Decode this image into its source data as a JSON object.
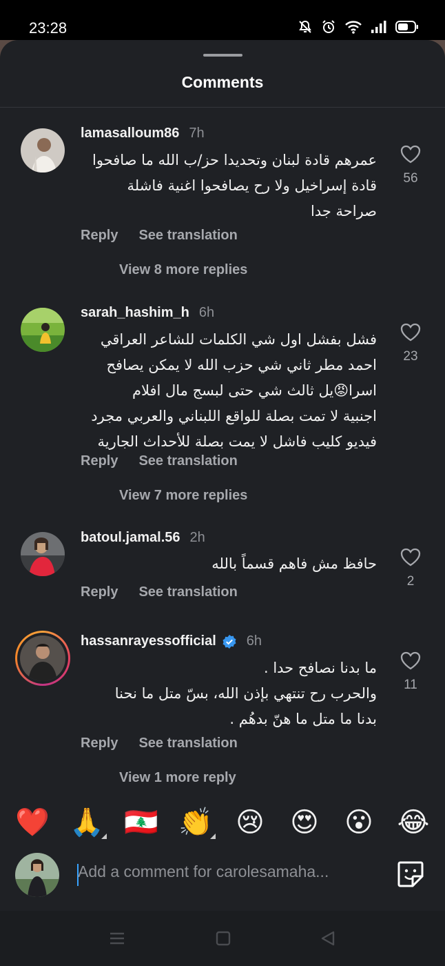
{
  "status_bar": {
    "time": "23:28",
    "icons": [
      "mute-icon",
      "alarm-icon",
      "wifi-icon",
      "signal-icon",
      "battery-icon"
    ]
  },
  "sheet": {
    "title": "Comments"
  },
  "actions": {
    "reply": "Reply",
    "see_translation": "See translation"
  },
  "comments": [
    {
      "username": "lamasalloum86",
      "time": "7h",
      "lines": [
        "عمرهم قادة لبنان وتحديدا حز/ب الله ما صافحوا",
        "قادة إسراخيل ولا رح يصافحوا اغنية فاشلة",
        "صراحة جدا"
      ],
      "likes": "56",
      "view_more": "View 8 more replies"
    },
    {
      "username": "sarah_hashim_h",
      "time": "6h",
      "lines": [
        "فشل بفشل اول شي الكلمات للشاعر العراقي",
        "احمد مطر ثاني شي حزب الله لا يمكن يصافح",
        "اسرا😡يل ثالث شي حتى لبسج مال افلام",
        "اجنبية لا تمت بصلة للواقع اللبناني والعربي مجرد",
        "فيديو كليب فاشل لا يمت بصلة للأحداث الجارية"
      ],
      "likes": "23",
      "view_more": "View 7 more replies"
    },
    {
      "username": "batoul.jamal.56",
      "time": "2h",
      "lines": [
        "حافظ مش فاهم قسماً بالله"
      ],
      "likes": "2"
    },
    {
      "username": "hassanrayessofficial",
      "time": "6h",
      "verified": true,
      "lines": [
        "ما بدنا نصافح حدا .",
        "والحرب رح تنتهي بإذن الله، بسّ متل ما نحنا",
        "بدنا ما متل ما هنّ بدهُم ."
      ],
      "likes": "11",
      "view_more": "View 1 more reply"
    }
  ],
  "emoji_bar": [
    "❤️",
    "🙏",
    "🇱🇧",
    "👏",
    "😢",
    "😍",
    "😮",
    "😂"
  ],
  "composer": {
    "placeholder": "Add a comment for carolesamaha..."
  },
  "colors": {
    "sheet_bg": "#1f2125",
    "verified_blue": "#3897f0",
    "caret": "#38a3ff"
  }
}
